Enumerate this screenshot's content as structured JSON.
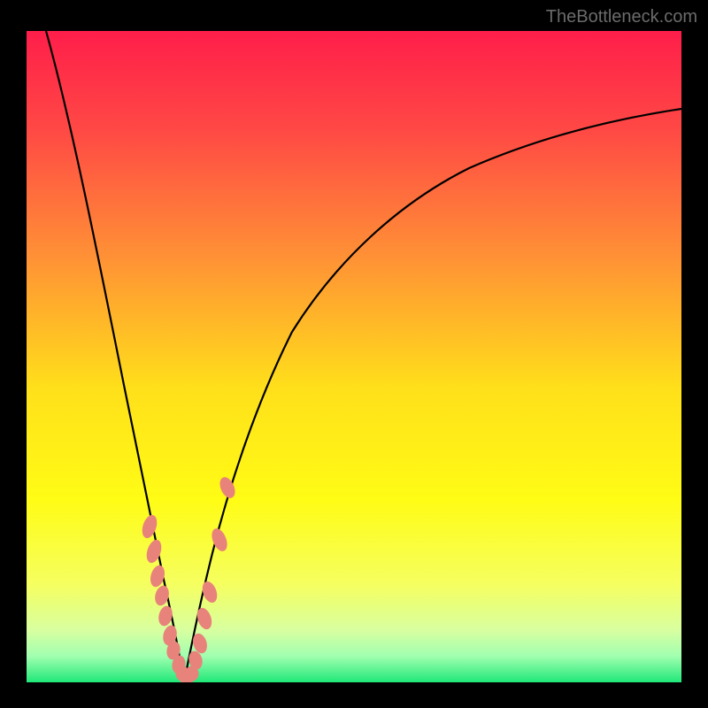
{
  "watermark": "TheBottleneck.com",
  "chart_data": {
    "type": "line",
    "title": "",
    "xlabel": "",
    "ylabel": "",
    "xlim": [
      0,
      100
    ],
    "ylim": [
      0,
      100
    ],
    "background_gradient": {
      "type": "vertical",
      "stops": [
        {
          "pos": 0.0,
          "color": "#ff1e4a"
        },
        {
          "pos": 0.15,
          "color": "#ff4845"
        },
        {
          "pos": 0.35,
          "color": "#ff9235"
        },
        {
          "pos": 0.55,
          "color": "#ffe01a"
        },
        {
          "pos": 0.72,
          "color": "#fffc15"
        },
        {
          "pos": 0.85,
          "color": "#f5ff60"
        },
        {
          "pos": 0.92,
          "color": "#d8ffa0"
        },
        {
          "pos": 0.96,
          "color": "#a0ffb0"
        },
        {
          "pos": 1.0,
          "color": "#20e878"
        }
      ]
    },
    "series": [
      {
        "name": "left-curve",
        "type": "line",
        "color": "#000000",
        "x": [
          3,
          6,
          9,
          12,
          14,
          16,
          18,
          19,
          20,
          21,
          22,
          23,
          24
        ],
        "y": [
          100,
          85,
          70,
          55,
          45,
          35,
          25,
          18,
          12,
          8,
          5,
          2,
          0
        ]
      },
      {
        "name": "right-curve",
        "type": "line",
        "color": "#000000",
        "x": [
          24,
          26,
          28,
          31,
          35,
          40,
          46,
          53,
          61,
          70,
          80,
          90,
          100
        ],
        "y": [
          0,
          5,
          12,
          22,
          33,
          44,
          53,
          61,
          68,
          73,
          78,
          81,
          84
        ]
      },
      {
        "name": "data-points",
        "type": "scatter",
        "color": "#e8837c",
        "marker": "pill",
        "x": [
          18.8,
          19.4,
          20.0,
          20.6,
          21.2,
          21.9,
          22.5,
          23.2,
          23.8,
          24.5,
          25.2,
          25.8,
          26.4,
          27.2,
          28.0,
          29.4,
          30.7
        ],
        "y": [
          24,
          20,
          16,
          13,
          10,
          7,
          5,
          3,
          1.5,
          0.5,
          1.5,
          3.5,
          6,
          10,
          14,
          22,
          30
        ]
      }
    ]
  }
}
